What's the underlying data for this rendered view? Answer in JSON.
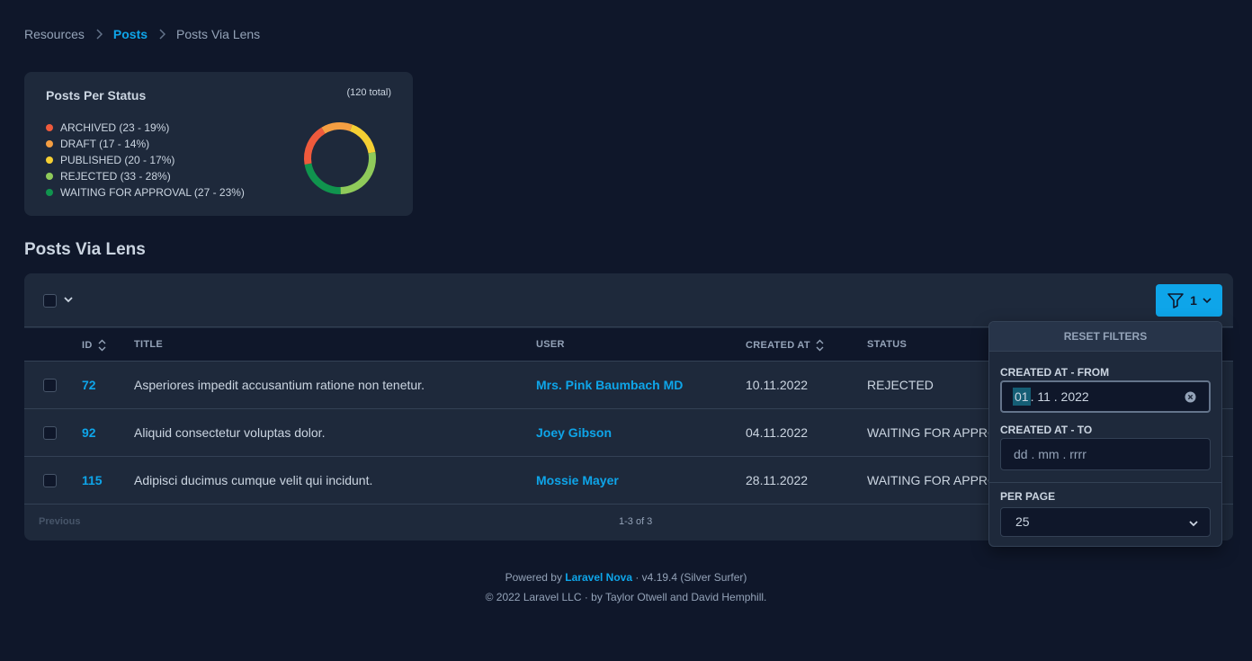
{
  "breadcrumb": [
    "Resources",
    "Posts",
    "Posts Via Lens"
  ],
  "metric": {
    "title": "Posts Per Status",
    "total": "(120 total)",
    "legend": [
      {
        "label": "ARCHIVED (23 - 19%)",
        "color": "#ef5a3c",
        "value": 23
      },
      {
        "label": "DRAFT (17 - 14%)",
        "color": "#f59e42",
        "value": 17
      },
      {
        "label": "PUBLISHED (20 - 17%)",
        "color": "#f5cf33",
        "value": 20
      },
      {
        "label": "REJECTED (33 - 28%)",
        "color": "#8fca5a",
        "value": 33
      },
      {
        "label": "WAITING FOR APPROVAL (27 - 23%)",
        "color": "#10944e",
        "value": 27
      }
    ]
  },
  "section_title": "Posts Via Lens",
  "filter_button": {
    "count": "1"
  },
  "columns": {
    "id": "ID",
    "title": "TITLE",
    "user": "USER",
    "created_at": "CREATED AT",
    "status": "STATUS"
  },
  "rows": [
    {
      "id": "72",
      "title": "Asperiores impedit accusantium ratione non tenetur.",
      "user": "Mrs. Pink Baumbach MD",
      "created_at": "10.11.2022",
      "status": "REJECTED"
    },
    {
      "id": "92",
      "title": "Aliquid consectetur voluptas dolor.",
      "user": "Joey Gibson",
      "created_at": "04.11.2022",
      "status": "WAITING FOR APPROVAL"
    },
    {
      "id": "115",
      "title": "Adipisci ducimus cumque velit qui incidunt.",
      "user": "Mossie Mayer",
      "created_at": "28.11.2022",
      "status": "WAITING FOR APPROVAL"
    }
  ],
  "pagination": {
    "previous": "Previous",
    "count": "1-3 of 3"
  },
  "filters": {
    "reset": "RESET FILTERS",
    "from_label": "CREATED AT - FROM",
    "from_day": "01",
    "from_rest": ". 11 . 2022",
    "to_label": "CREATED AT - TO",
    "to_placeholder": "dd . mm . rrrr",
    "per_page_label": "PER PAGE",
    "per_page_value": "25"
  },
  "footer": {
    "powered": "Powered by ",
    "brand": "Laravel Nova",
    "version": " · v4.19.4 (Silver Surfer)",
    "copyright": "© 2022 Laravel LLC · by Taylor Otwell and David Hemphill."
  }
}
